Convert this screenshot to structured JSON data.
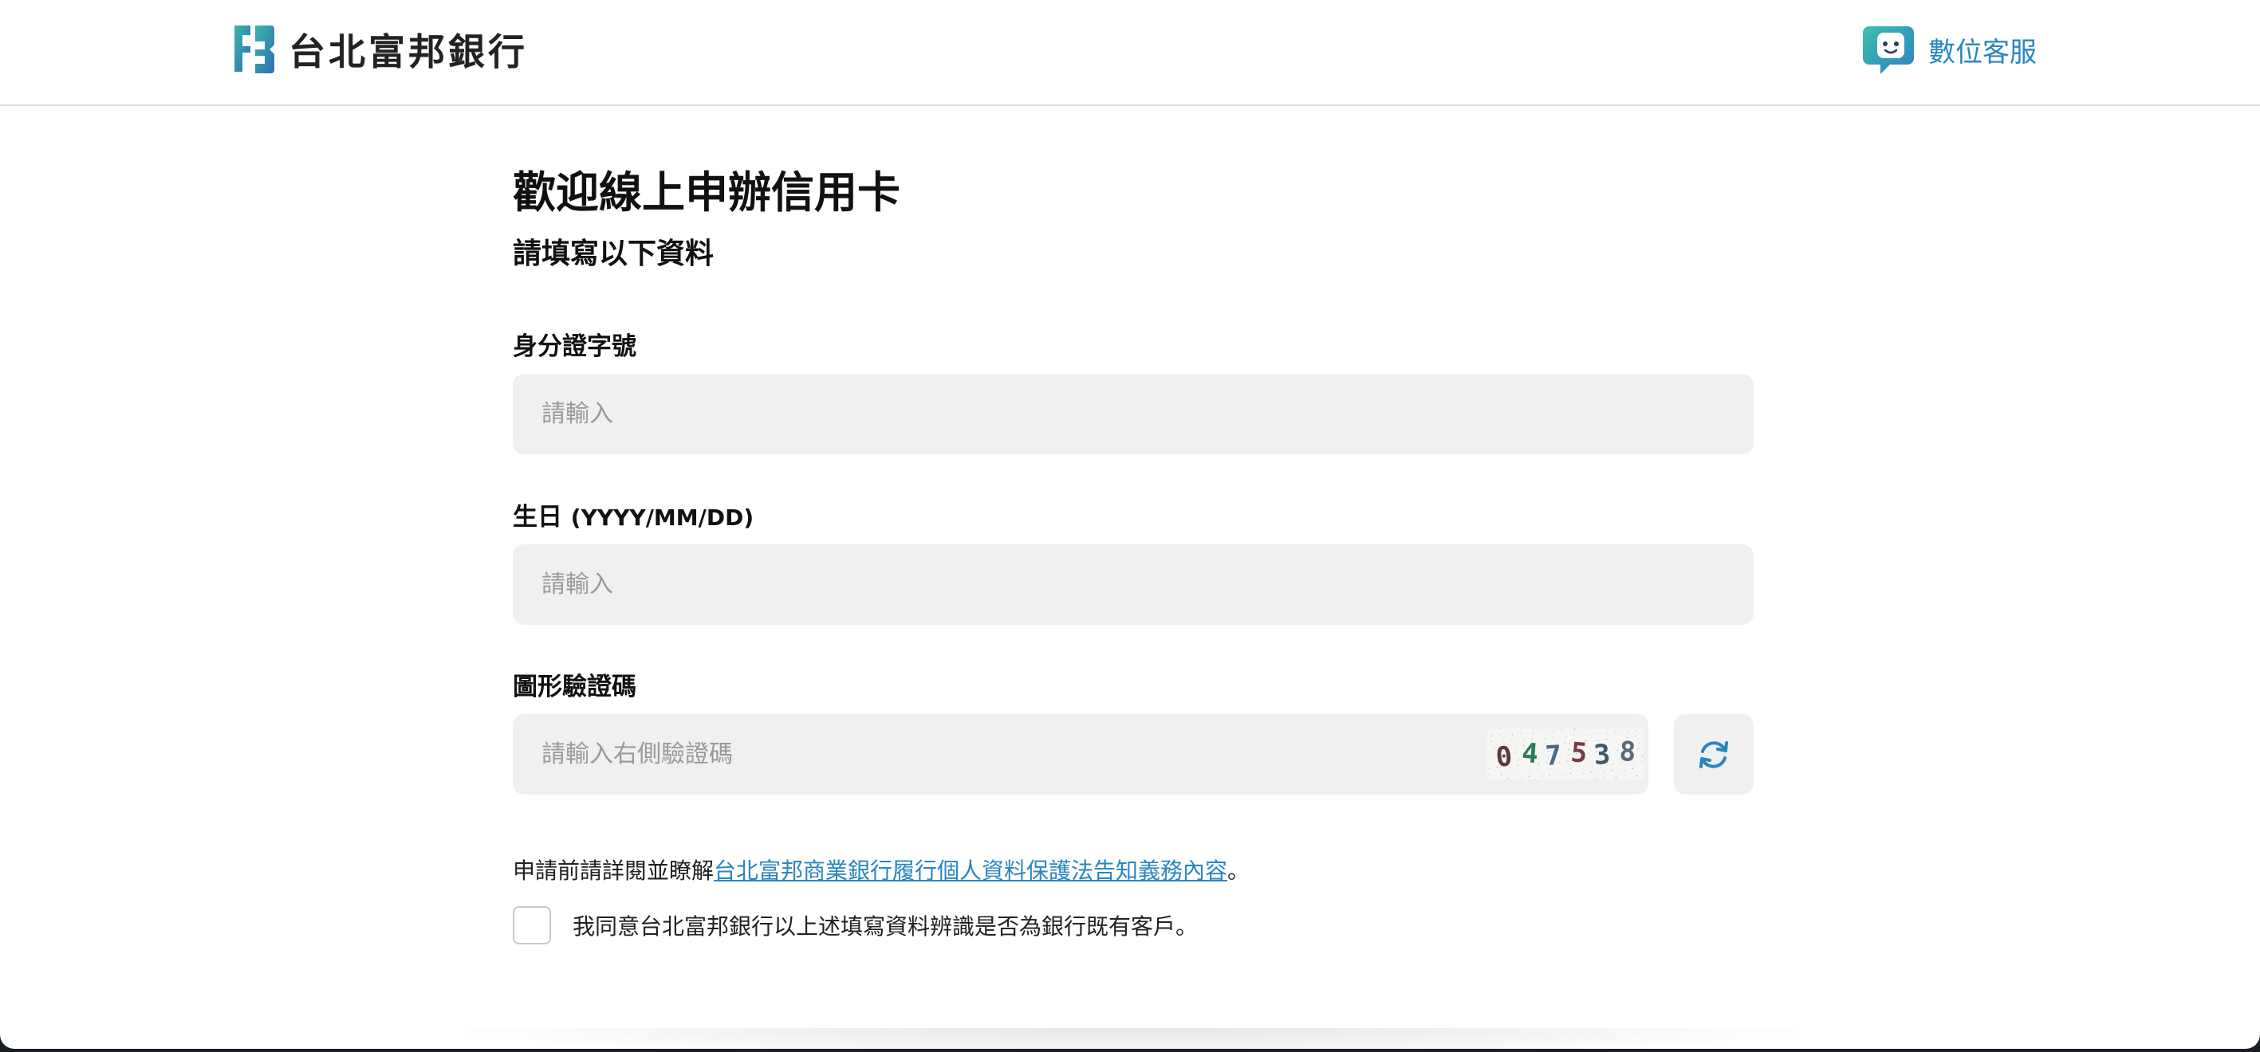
{
  "header": {
    "bank_name": "台北富邦銀行",
    "support_label": "數位客服"
  },
  "form": {
    "title": "歡迎線上申辦信用卡",
    "subtitle": "請填寫以下資料",
    "id_field": {
      "label": "身分證字號",
      "placeholder": "請輸入"
    },
    "birthday_field": {
      "label": "生日",
      "hint": "(YYYY/MM/DD)",
      "placeholder": "請輸入"
    },
    "captcha_field": {
      "label": "圖形驗證碼",
      "placeholder": "請輸入右側驗證碼",
      "code": "047538"
    },
    "notice": {
      "prefix": "申請前請詳閱並瞭解",
      "link_text": "台北富邦商業銀行履行個人資料保護法告知義務內容",
      "suffix": "。"
    },
    "agreement": {
      "label": "我同意台北富邦銀行以上述填寫資料辨識是否為銀行既有客戶。",
      "checked": false
    }
  },
  "colors": {
    "accent": "#2a86c0",
    "input_bg": "#eff0f0",
    "logo_teal": "#3aa7a0",
    "logo_blue": "#2a77b8"
  },
  "icons": {
    "support": "chatbot-face-icon",
    "refresh": "refresh-icon",
    "logo": "fubon-logo-icon"
  }
}
